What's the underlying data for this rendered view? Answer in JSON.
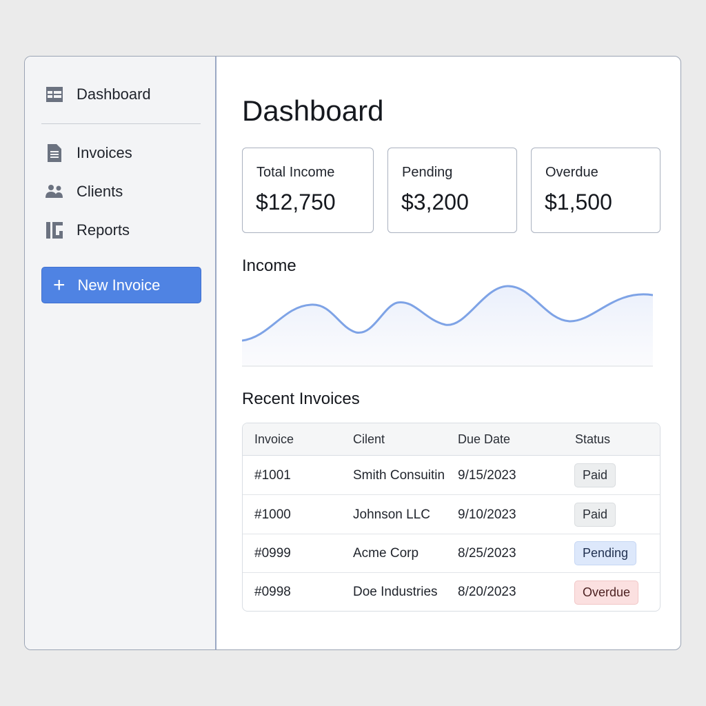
{
  "sidebar": {
    "items": [
      {
        "label": "Dashboard",
        "icon": "dashboard-icon"
      },
      {
        "label": "Invoices",
        "icon": "document-icon"
      },
      {
        "label": "Clients",
        "icon": "users-icon"
      },
      {
        "label": "Reports",
        "icon": "reports-icon"
      }
    ],
    "new_invoice_label": "New Invoice"
  },
  "main": {
    "title": "Dashboard",
    "cards": [
      {
        "label": "Total Income",
        "value": "$12,750"
      },
      {
        "label": "Pending",
        "value": "$3,200"
      },
      {
        "label": "Overdue",
        "value": "$1,500"
      }
    ],
    "income_title": "Income",
    "recent_title": "Recent Invoices",
    "table": {
      "columns": [
        "Invoice",
        "Cilent",
        "Due Date",
        "Status"
      ],
      "rows": [
        {
          "invoice": "#1001",
          "client": "Smith Consuitin",
          "due": "9/15/2023",
          "status": "Paid"
        },
        {
          "invoice": "#1000",
          "client": "Johnson LLC",
          "due": "9/10/2023",
          "status": "Paid"
        },
        {
          "invoice": "#0999",
          "client": "Acme Corp",
          "due": "8/25/2023",
          "status": "Pending"
        },
        {
          "invoice": "#0998",
          "client": "Doe Industries",
          "due": "8/20/2023",
          "status": "Overdue"
        }
      ]
    }
  },
  "colors": {
    "accent": "#4f83e3",
    "chart_line": "#7ea3e6",
    "pending_badge": "#dde8fb",
    "overdue_badge": "#fbe0e0",
    "paid_badge": "#eceeef"
  }
}
